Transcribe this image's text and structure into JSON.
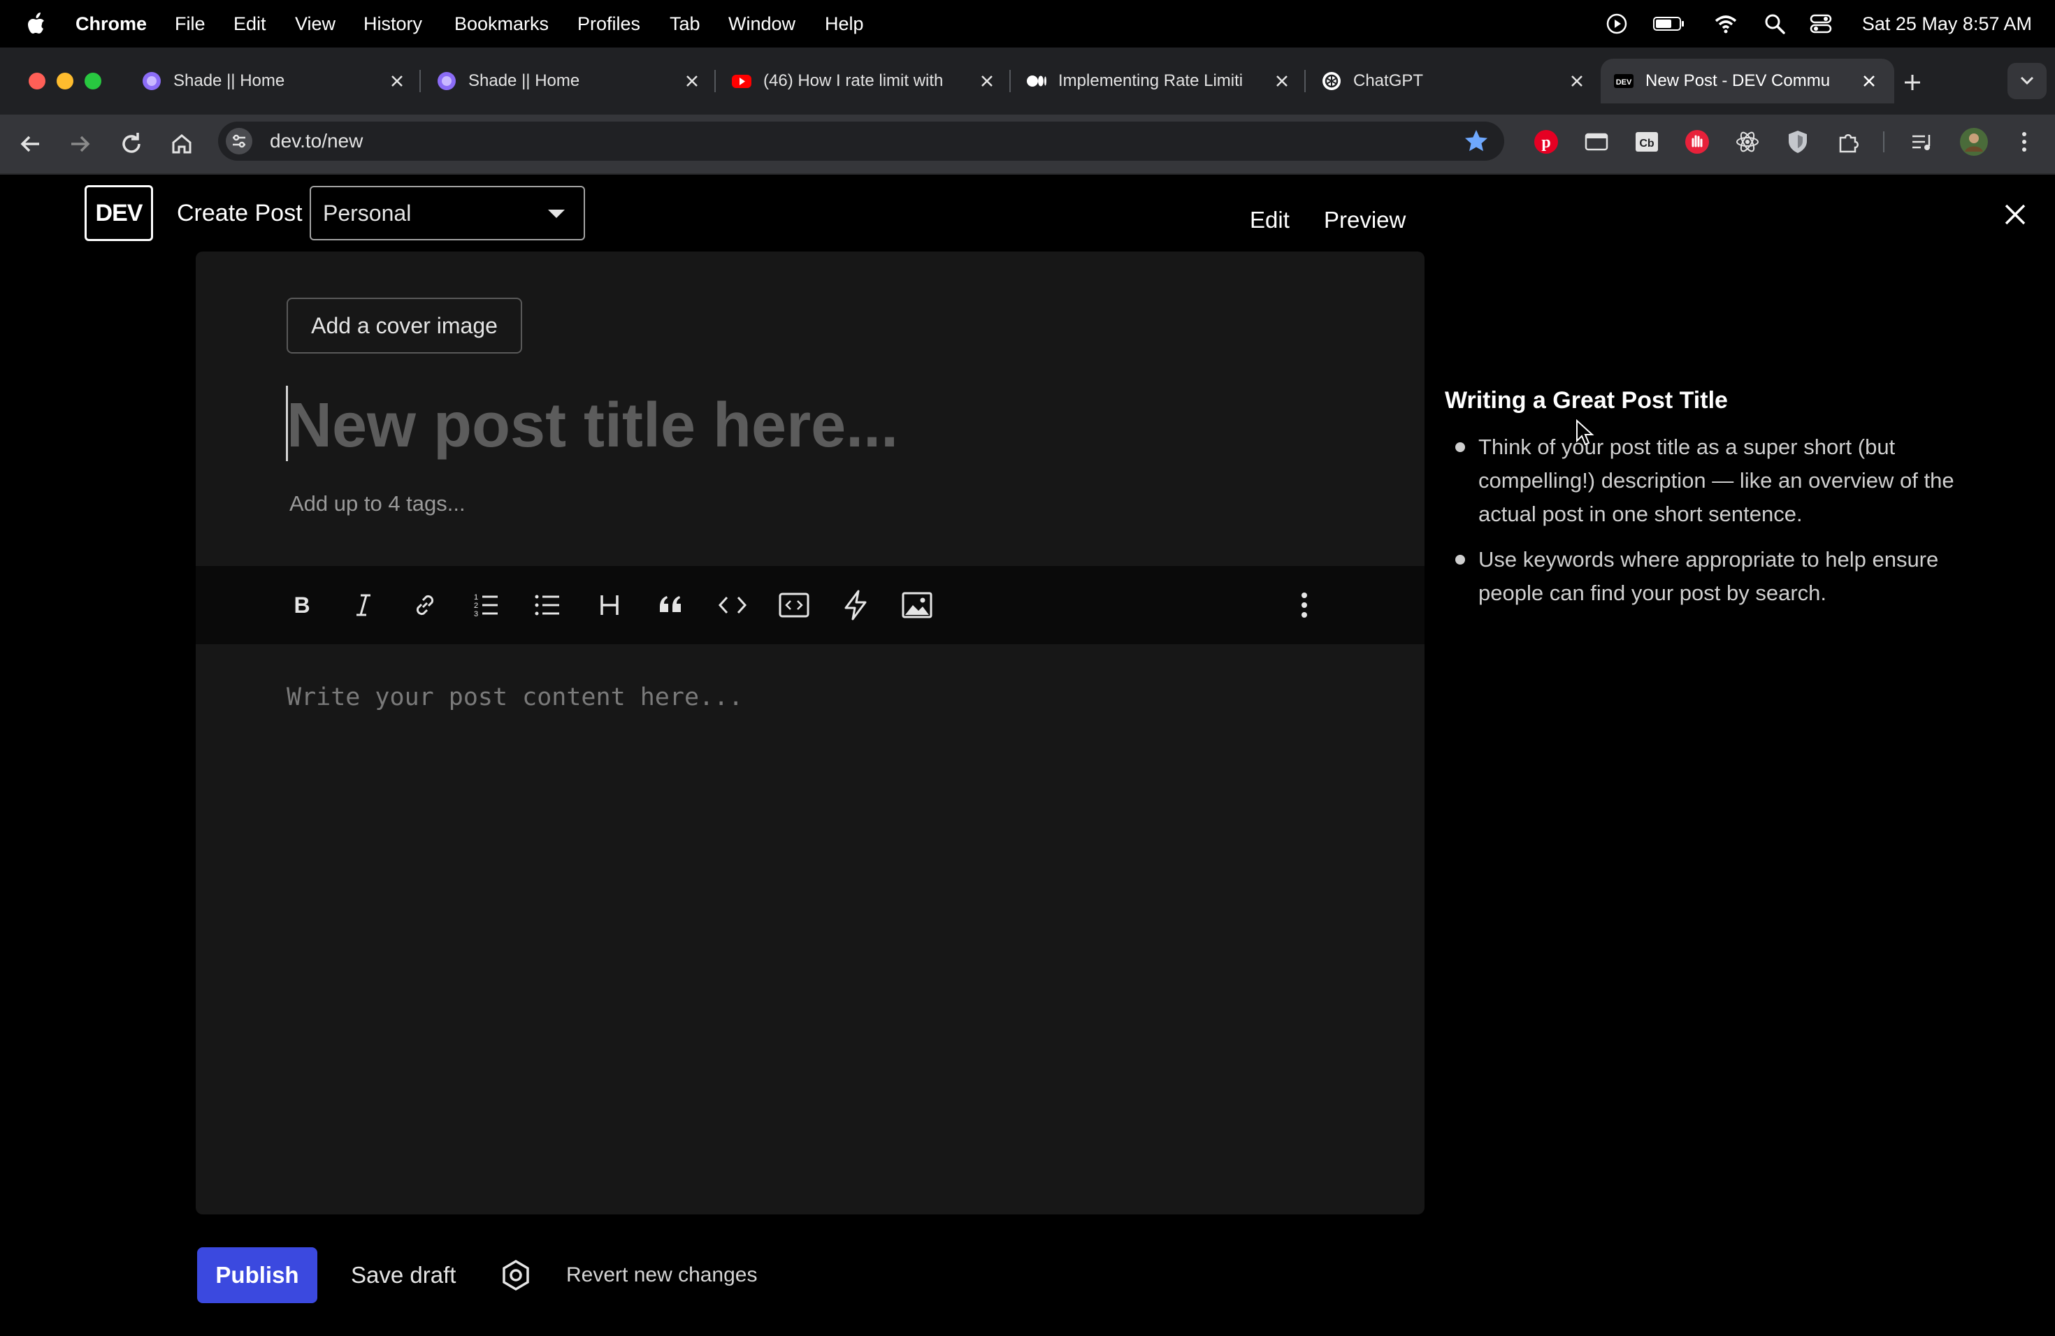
{
  "menubar": {
    "app_name": "Chrome",
    "items": [
      "File",
      "Edit",
      "View",
      "History",
      "Bookmarks",
      "Profiles",
      "Tab",
      "Window",
      "Help"
    ],
    "clock": "Sat 25 May  8:57 AM"
  },
  "browser": {
    "tabs": [
      {
        "title": "Shade || Home",
        "icon": "shade-favicon-icon"
      },
      {
        "title": "Shade || Home",
        "icon": "shade-favicon-icon"
      },
      {
        "title": "(46) How I rate limit with",
        "icon": "youtube-icon"
      },
      {
        "title": "Implementing Rate Limiti",
        "icon": "medium-icon"
      },
      {
        "title": "ChatGPT",
        "icon": "chatgpt-icon"
      },
      {
        "title": "New Post - DEV Commu",
        "icon": "dev-favicon-icon",
        "active": true
      }
    ],
    "url": "dev.to/new"
  },
  "header": {
    "logo": "DEV",
    "create_post": "Create Post",
    "org_select": "Personal",
    "edit_tab": "Edit",
    "preview_tab": "Preview"
  },
  "editor": {
    "cover_button": "Add a cover image",
    "title_placeholder": "New post title here...",
    "tags_placeholder": "Add up to 4 tags...",
    "body_placeholder": "Write your post content here...",
    "toolbar": [
      "bold",
      "italic",
      "link",
      "ordered-list",
      "unordered-list",
      "heading",
      "quote",
      "code",
      "code-block",
      "embed",
      "image",
      "more"
    ]
  },
  "tips": {
    "title": "Writing a Great Post Title",
    "items": [
      "Think of your post title as a super short (but compelling!) description — like an overview of the actual post in one short sentence.",
      "Use keywords where appropriate to help ensure people can find your post by search."
    ]
  },
  "footer": {
    "publish": "Publish",
    "save_draft": "Save draft",
    "revert": "Revert new changes"
  },
  "colors": {
    "accent": "#3b49df",
    "editor_bg": "#171717",
    "page_bg": "#000000"
  }
}
